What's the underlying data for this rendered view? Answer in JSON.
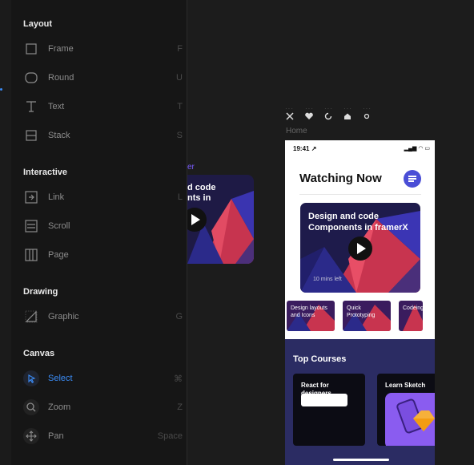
{
  "colors": {
    "accent": "#3b8cf6",
    "phone_accent": "#4a4ed6",
    "courses_bg": "#2b2c63"
  },
  "panel": {
    "sections": [
      {
        "title": "Layout",
        "tools": [
          {
            "label": "Frame",
            "key": "F",
            "icon": "frame-icon"
          },
          {
            "label": "Round",
            "key": "U",
            "icon": "round-icon"
          },
          {
            "label": "Text",
            "key": "T",
            "icon": "text-icon"
          },
          {
            "label": "Stack",
            "key": "S",
            "icon": "stack-icon"
          }
        ]
      },
      {
        "title": "Interactive",
        "tools": [
          {
            "label": "Link",
            "key": "L",
            "icon": "link-icon"
          },
          {
            "label": "Scroll",
            "key": "",
            "icon": "scroll-icon"
          },
          {
            "label": "Page",
            "key": "",
            "icon": "page-icon"
          }
        ]
      },
      {
        "title": "Drawing",
        "tools": [
          {
            "label": "Graphic",
            "key": "G",
            "icon": "graphic-icon"
          }
        ]
      },
      {
        "title": "Canvas",
        "tools": [
          {
            "label": "Select",
            "key": "⌘",
            "icon": "select-icon",
            "active": true
          },
          {
            "label": "Zoom",
            "key": "Z",
            "icon": "zoom-icon"
          },
          {
            "label": "Pan",
            "key": "Space",
            "icon": "pan-icon"
          }
        ]
      }
    ]
  },
  "canvas": {
    "label_fragment": "er",
    "bg_card_text": "d code\nnts in",
    "toolbar_icons": [
      "close-icon",
      "heart-icon",
      "refresh-icon",
      "home-icon",
      "circle-icon"
    ],
    "frame_name": "Home"
  },
  "phone": {
    "time": "19:41",
    "status_icons": "▂▄▆ ◠ ▭",
    "title": "Watching Now",
    "hero_title": "Design and code Components in framerX",
    "hero_meta": "10 mins left",
    "thumbs": [
      "Design layouts and Icons",
      "Quick Prototyping",
      "Codeing React"
    ],
    "courses_title": "Top Courses",
    "course_cards": [
      "React for designers",
      "Learn Sketch"
    ]
  }
}
